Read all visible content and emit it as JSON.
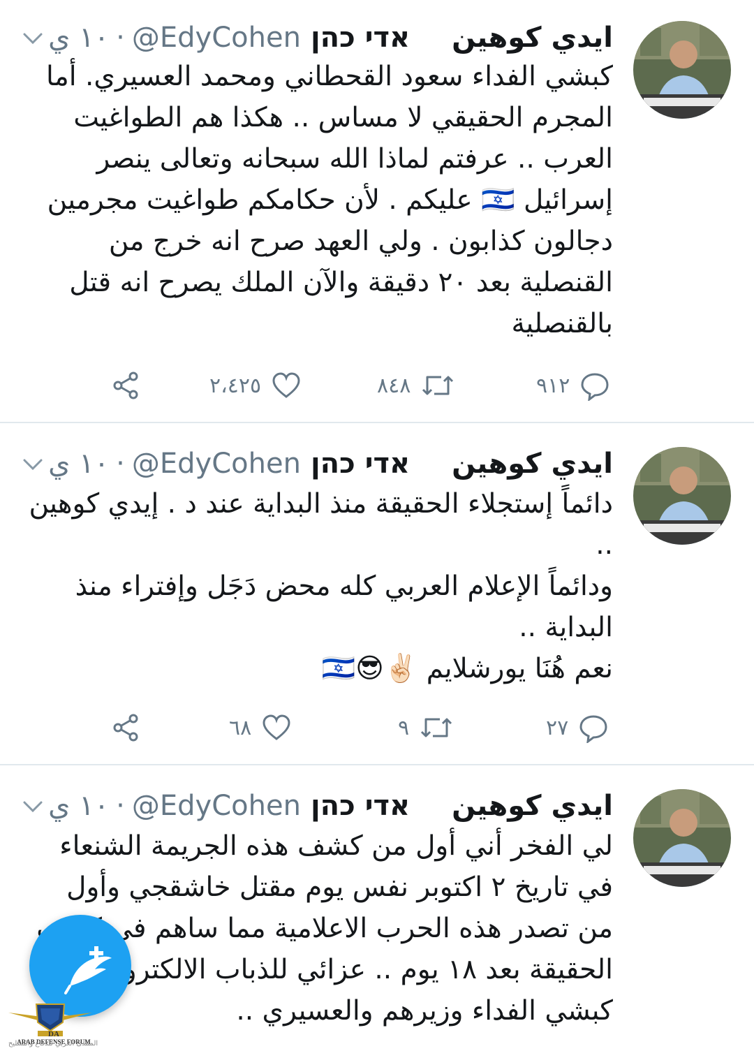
{
  "tweets": [
    {
      "name": "ايدي كوهين",
      "hebrew_name": "אדי כהן",
      "handle": "@EdyCohen",
      "dot": "·",
      "time": "١٠ ي",
      "lines": [
        "كبشي الفداء سعود القحطاني ومحمد العسيري. أما المجرم الحقيقي لا مساس .. هكذا هم الطواغيت العرب .. عرفتم لماذا الله سبحانه وتعالى ينصر إسرائيل 🇮🇱 عليكم . لأن حكامكم طواغيت مجرمين دجالون كذابون . ولي العهد صرح  انه خرج من القنصلية بعد ٢٠ دقيقة والآن الملك يصرح انه قتل بالقنصلية"
      ],
      "replies": "٩١٢",
      "retweets": "٨٤٨",
      "likes": "٢،٤٢٥"
    },
    {
      "name": "ايدي كوهين",
      "hebrew_name": "אדי כהן",
      "handle": "@EdyCohen",
      "dot": "·",
      "time": "١٠ ي",
      "lines": [
        "دائماً إستجلاء الحقيقة منذ البداية عند د . إيدي كوهين ..",
        "ودائماً الإعلام العربي كله محض دَجَل وإفتراء منذ البداية ..",
        "نعم هُنَا يورشلايم ✌🏻😎🇮🇱"
      ],
      "replies": "٢٧",
      "retweets": "٩",
      "likes": "٦٨"
    },
    {
      "name": "ايدي كوهين",
      "hebrew_name": "אדי כהן",
      "handle": "@EdyCohen",
      "dot": "·",
      "time": "١٠ ي",
      "lines": [
        "لي الفخر أني أول من كشف هذه الجريمة الشنعاء في تاريخ ٢ اكتوبر نفس يوم مقتل خاشقجي وأول من تصدر هذه الحرب الاعلامية مما ساهم في كشف الحقيقة بعد ١٨ يوم .. عزائي للذباب الالكتروني كبشي الفداء وزيرهم والعسيري .."
      ]
    }
  ],
  "watermark": {
    "logo_text": "ARAB DEFENSE FORUM",
    "logo_mark": "DA",
    "sub_text": "المنتدى العربي للدفاع والتسليح"
  },
  "colors": {
    "accent": "#1da1f2",
    "muted": "#657786",
    "text": "#14171a",
    "divider": "#e1e8ed"
  },
  "icons": [
    "chevron-down-icon",
    "reply-icon",
    "retweet-icon",
    "like-icon",
    "share-icon",
    "compose-tweet-icon"
  ]
}
